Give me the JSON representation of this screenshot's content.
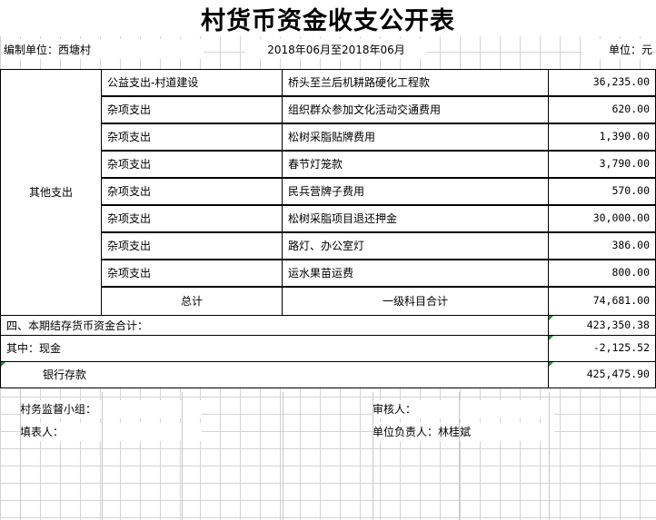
{
  "title": "村货币资金收支公开表",
  "header": {
    "unit_label": "编制单位：西塘村",
    "period": "2018年06月至2018年06月",
    "currency_unit": "单位：元"
  },
  "section": {
    "label": "其他支出"
  },
  "rows": [
    {
      "category": "公益支出-村道建设",
      "item": "桥头至兰后机耕路硬化工程款",
      "amount": "36,235.00"
    },
    {
      "category": "杂项支出",
      "item": "组织群众参加文化活动交通费用",
      "amount": "620.00"
    },
    {
      "category": "杂项支出",
      "item": "松树采脂贴牌费用",
      "amount": "1,390.00"
    },
    {
      "category": "杂项支出",
      "item": "春节灯笼款",
      "amount": "3,790.00"
    },
    {
      "category": "杂项支出",
      "item": "民兵营牌子费用",
      "amount": "570.00"
    },
    {
      "category": "杂项支出",
      "item": "松树采脂项目退还押金",
      "amount": "30,000.00"
    },
    {
      "category": "杂项支出",
      "item": "路灯、办公室灯",
      "amount": "386.00"
    },
    {
      "category": "杂项支出",
      "item": "运水果苗运费",
      "amount": "800.00"
    }
  ],
  "total": {
    "label": "总计",
    "level_label": "一级科目合计",
    "amount": "74,681.00"
  },
  "balance": {
    "label": "四、本期结存货币资金合计：",
    "amount": "423,350.38"
  },
  "cash": {
    "label": "其中：现金",
    "amount": "-2,125.52"
  },
  "bank": {
    "label": "银行存款",
    "amount": "425,475.90"
  },
  "signatures": {
    "supervision": "村务监督小组：",
    "reviewer": "审核人：",
    "preparer": "填表人：",
    "leader": "单位负责人：林桂斌"
  }
}
